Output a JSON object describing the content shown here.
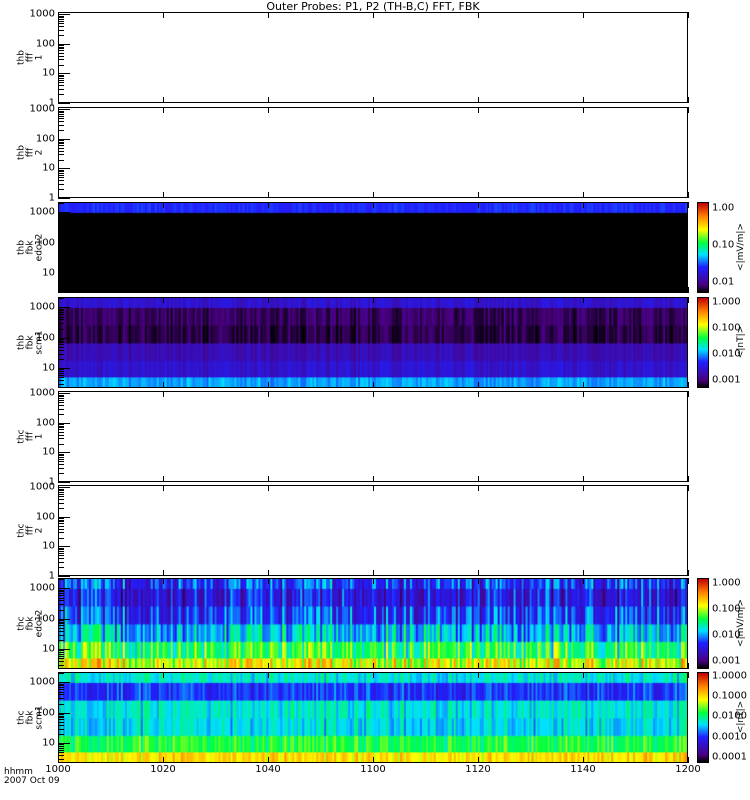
{
  "chart_data": {
    "type": "heatmap",
    "title": "Outer Probes: P1, P2 (TH-B,C) FFT, FBK",
    "xaxis": {
      "label": "hhmm",
      "date": "2007 Oct 09",
      "range": [
        1000,
        1200
      ],
      "ticks": [
        "1000",
        "1020",
        "1040",
        "1100",
        "1120",
        "1140",
        "1200"
      ]
    },
    "panels": [
      {
        "ylabel": [
          "thb",
          "fff",
          "1"
        ],
        "yrange": [
          1,
          1200
        ],
        "yticks": [
          "1000",
          "100",
          "10",
          "1"
        ],
        "empty": true
      },
      {
        "ylabel": [
          "thb",
          "fff",
          "2"
        ],
        "yrange": [
          1,
          1200
        ],
        "yticks": [
          "1000",
          "100",
          "10",
          "1"
        ],
        "empty": true
      },
      {
        "ylabel": [
          "thb",
          "fbk",
          "edc12"
        ],
        "yrange": [
          2.2,
          2200
        ],
        "yticks": [
          "1000",
          "100",
          "10"
        ],
        "empty": false,
        "zrange": [
          0.005,
          1.5
        ],
        "zticks": [
          "1.00",
          "0.10",
          "0.01"
        ],
        "zunit": "<|mV/m|>",
        "band_log_levels": [
          -4,
          -4,
          -4,
          -4,
          -4,
          -1.6
        ],
        "variability": 0.05
      },
      {
        "ylabel": [
          "thb",
          "fbk",
          "scm1"
        ],
        "yrange": [
          2.2,
          2200
        ],
        "yticks": [
          "1000",
          "100",
          "10"
        ],
        "empty": false,
        "zrange": [
          0.0005,
          1.5
        ],
        "zticks": [
          "1.000",
          "0.100",
          "0.010",
          "0.001"
        ],
        "zunit": "<|nT|>",
        "band_log_levels": [
          -2.0,
          -2.6,
          -2.75,
          -3.15,
          -3.1,
          -2.6
        ],
        "variability": 0.12
      },
      {
        "ylabel": [
          "thc",
          "fff",
          "1"
        ],
        "yrange": [
          1,
          1200
        ],
        "yticks": [
          "1000",
          "100",
          "10",
          "1"
        ],
        "empty": true
      },
      {
        "ylabel": [
          "thc",
          "fff",
          "2"
        ],
        "yrange": [
          1,
          1200
        ],
        "yticks": [
          "1000",
          "100",
          "10",
          "1"
        ],
        "empty": true
      },
      {
        "ylabel": [
          "thc",
          "fbk",
          "edc12"
        ],
        "yrange": [
          2.2,
          2200
        ],
        "yticks": [
          "1000",
          "100",
          "10"
        ],
        "empty": false,
        "zrange": [
          0.0005,
          1.5
        ],
        "zticks": [
          "1.000",
          "0.100",
          "0.010",
          "0.001"
        ],
        "zunit": "<|mV/m|>",
        "band_log_levels": [
          -0.9,
          -1.4,
          -1.9,
          -2.3,
          -2.5,
          -2.3
        ],
        "variability": 0.45
      },
      {
        "ylabel": [
          "thc",
          "fbk",
          "scm1"
        ],
        "yrange": [
          2.2,
          2200
        ],
        "yticks": [
          "1000",
          "100",
          "10"
        ],
        "empty": false,
        "zrange": [
          5e-05,
          1.5
        ],
        "zticks": [
          "1.0000",
          "0.1000",
          "0.0100",
          "0.0010",
          "0.0001"
        ],
        "zunit": "<|nT|>",
        "band_log_levels": [
          -1.0,
          -1.8,
          -2.4,
          -2.3,
          -3.0,
          -2.3
        ],
        "variability": 0.3
      }
    ]
  }
}
